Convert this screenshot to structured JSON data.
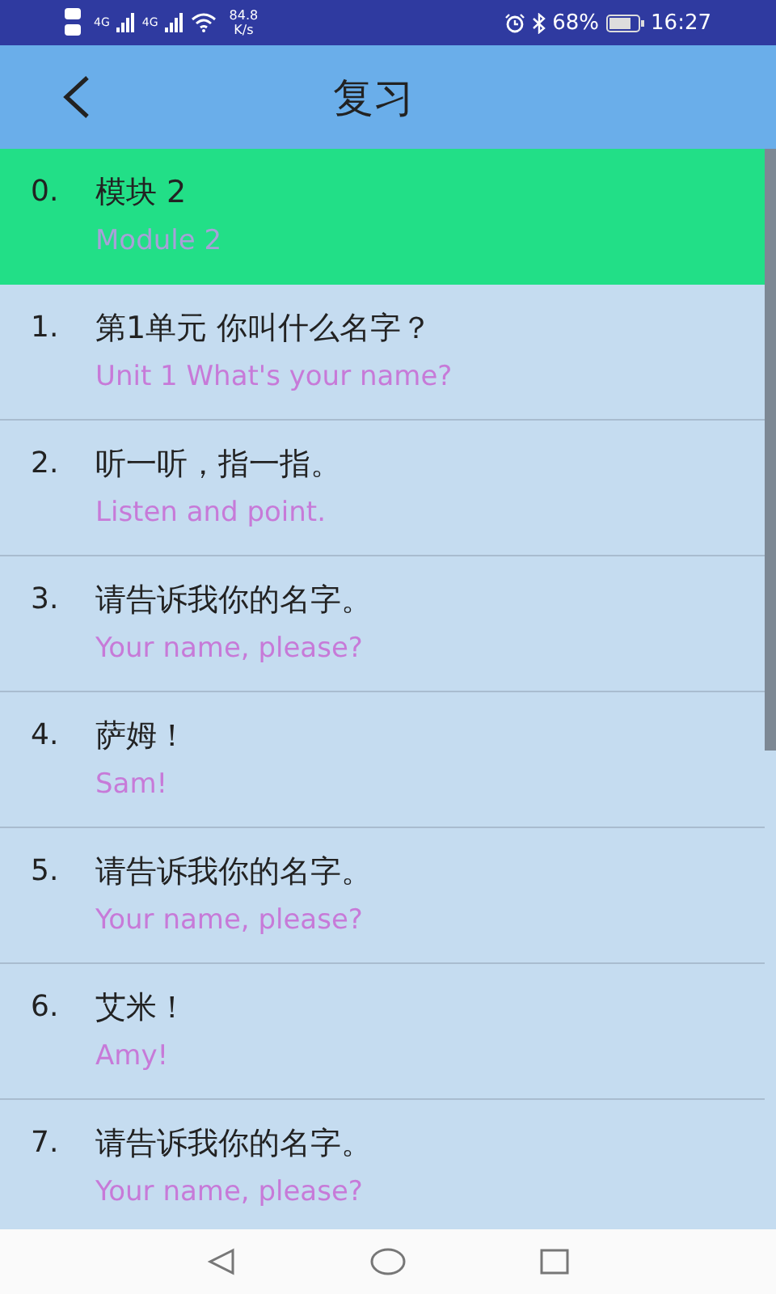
{
  "status_bar": {
    "network_type_1": "4G",
    "network_type_2": "4G",
    "speed_value": "84.8",
    "speed_unit": "K/s",
    "battery": "68%",
    "time": "16:27"
  },
  "header": {
    "title": "复习"
  },
  "items": [
    {
      "number": "0.",
      "chinese": "模块 2",
      "english": "Module 2",
      "selected": true
    },
    {
      "number": "1.",
      "chinese": "第1单元 你叫什么名字？",
      "english": "Unit 1 What's your name?",
      "selected": false
    },
    {
      "number": "2.",
      "chinese": "听一听，指一指。",
      "english": "Listen and point.",
      "selected": false
    },
    {
      "number": "3.",
      "chinese": "请告诉我你的名字。",
      "english": "Your name, please?",
      "selected": false
    },
    {
      "number": "4.",
      "chinese": "萨姆！",
      "english": "Sam!",
      "selected": false
    },
    {
      "number": "5.",
      "chinese": "请告诉我你的名字。",
      "english": "Your name, please?",
      "selected": false
    },
    {
      "number": "6.",
      "chinese": "艾米！",
      "english": "Amy!",
      "selected": false
    },
    {
      "number": "7.",
      "chinese": "请告诉我你的名字。",
      "english": "Your name, please?",
      "selected": false
    }
  ]
}
